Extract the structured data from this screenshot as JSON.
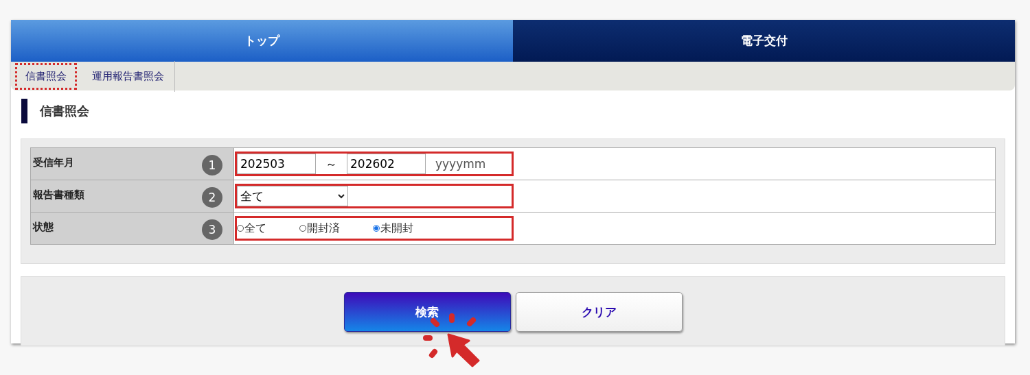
{
  "nav_tabs": [
    {
      "label": "トップ",
      "selected": false
    },
    {
      "label": "電子交付",
      "selected": true
    }
  ],
  "sub_nav": [
    {
      "label": "信書照会",
      "highlighted": true
    },
    {
      "label": "運用報告書照会",
      "highlighted": false
    }
  ],
  "heading": "信書照会",
  "form_rows": [
    {
      "kind": "range",
      "label": "受信年月",
      "number": "1",
      "highlighted": true,
      "from": "202503",
      "separator": "～",
      "to": "202602",
      "format_hint": "yyyymm"
    },
    {
      "kind": "select",
      "label": "報告書種類",
      "number": "2",
      "highlighted": true,
      "value": "全て"
    },
    {
      "kind": "radio",
      "label": "状態",
      "number": "3",
      "highlighted": true,
      "options": [
        {
          "label": "全て",
          "selected": false
        },
        {
          "label": "開封済",
          "selected": false
        },
        {
          "label": "未開封",
          "selected": true
        }
      ]
    }
  ],
  "buttons": [
    {
      "kind": "primary",
      "label": "検索",
      "clicked": true
    },
    {
      "kind": "secondary",
      "label": "クリア",
      "clicked": false
    }
  ]
}
